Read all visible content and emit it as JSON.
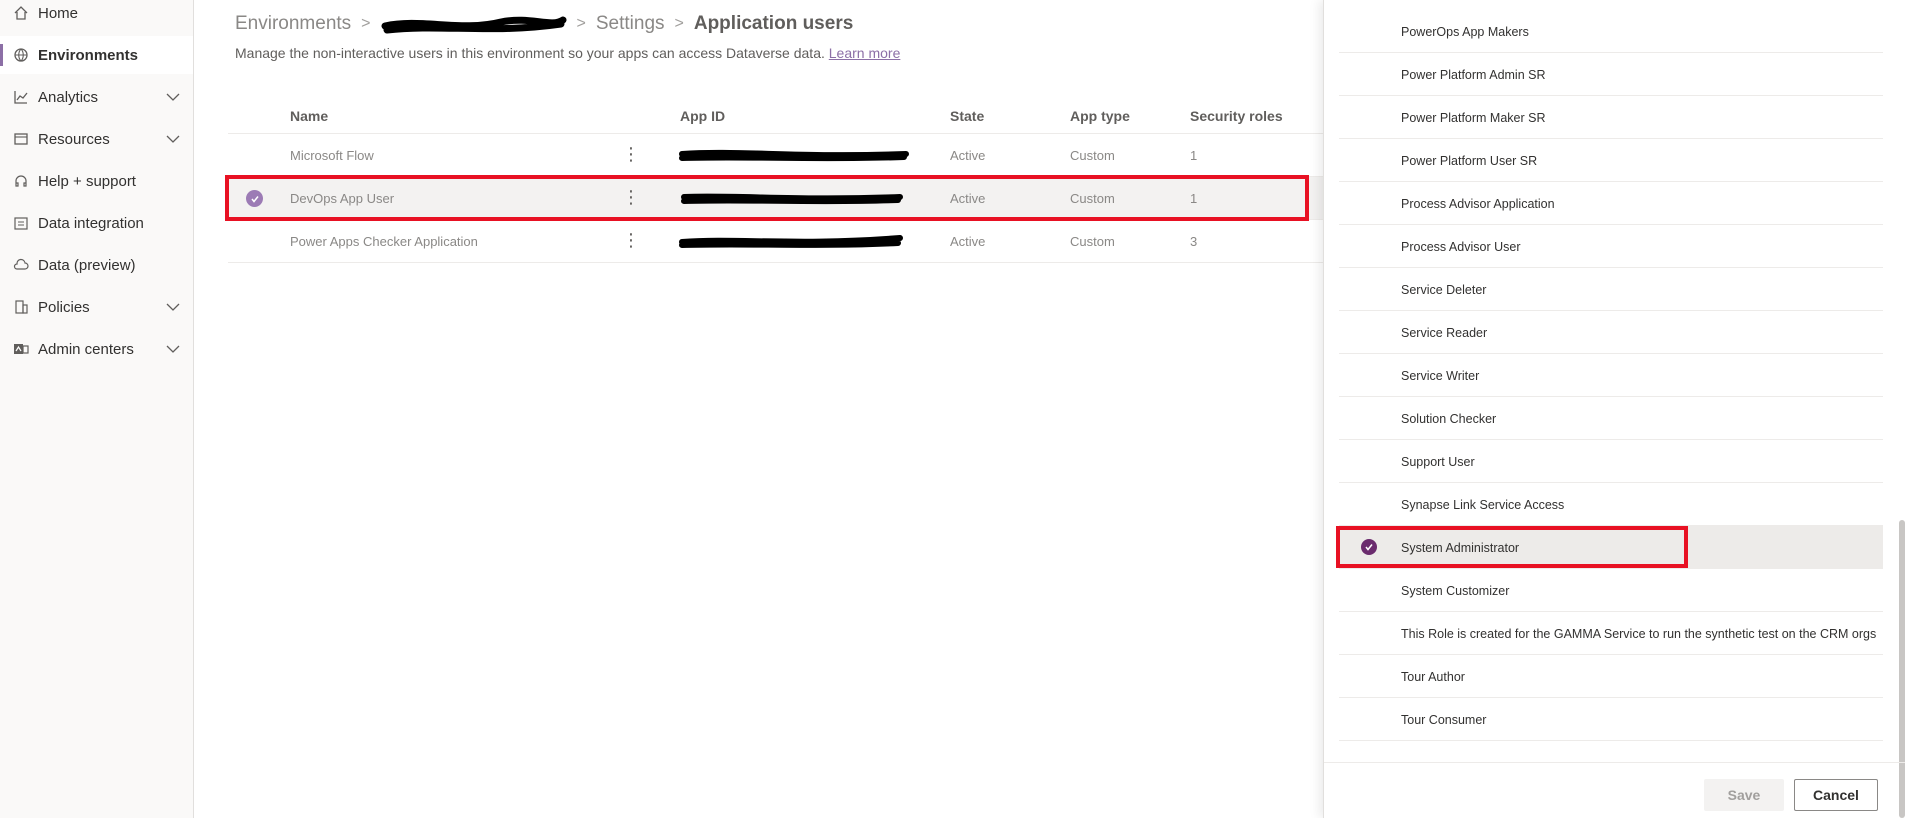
{
  "nav": {
    "items": [
      {
        "label": "Home",
        "icon": "home-icon"
      },
      {
        "label": "Environments",
        "icon": "environments-icon"
      },
      {
        "label": "Analytics",
        "icon": "analytics-icon"
      },
      {
        "label": "Resources",
        "icon": "resources-icon"
      },
      {
        "label": "Help + support",
        "icon": "headset-icon"
      },
      {
        "label": "Data integration",
        "icon": "data-integration-icon"
      },
      {
        "label": "Data (preview)",
        "icon": "cloud-icon"
      },
      {
        "label": "Policies",
        "icon": "policies-icon"
      },
      {
        "label": "Admin centers",
        "icon": "admin-centers-icon"
      }
    ]
  },
  "breadcrumb": {
    "root": "Environments",
    "settings": "Settings",
    "current": "Application users"
  },
  "description": {
    "text": "Manage the non-interactive users in this environment so your apps can access Dataverse data.",
    "link": "Learn more"
  },
  "grid": {
    "columns": {
      "name": "Name",
      "app_id": "App ID",
      "state": "State",
      "app_type": "App type",
      "security_roles": "Security roles"
    },
    "rows": [
      {
        "name": "Microsoft Flow",
        "state": "Active",
        "app_type": "Custom",
        "roles": "1"
      },
      {
        "name": "DevOps App User",
        "state": "Active",
        "app_type": "Custom",
        "roles": "1"
      },
      {
        "name": "Power Apps Checker Application",
        "state": "Active",
        "app_type": "Custom",
        "roles": "3"
      }
    ]
  },
  "panel": {
    "roles": [
      "PowerOps App Makers",
      "Power Platform Admin SR",
      "Power Platform Maker SR",
      "Power Platform User SR",
      "Process Advisor Application",
      "Process Advisor User",
      "Service Deleter",
      "Service Reader",
      "Service Writer",
      "Solution Checker",
      "Support User",
      "Synapse Link Service Access",
      "System Administrator",
      "System Customizer",
      "This Role is created for the GAMMA Service to run the synthetic test on the CRM orgs",
      "Tour Author",
      "Tour Consumer"
    ],
    "save_label": "Save",
    "cancel_label": "Cancel"
  },
  "colors": {
    "accent": "#8c6fa6",
    "highlight": "#e81123",
    "selected_check": "#6b2c6e"
  }
}
